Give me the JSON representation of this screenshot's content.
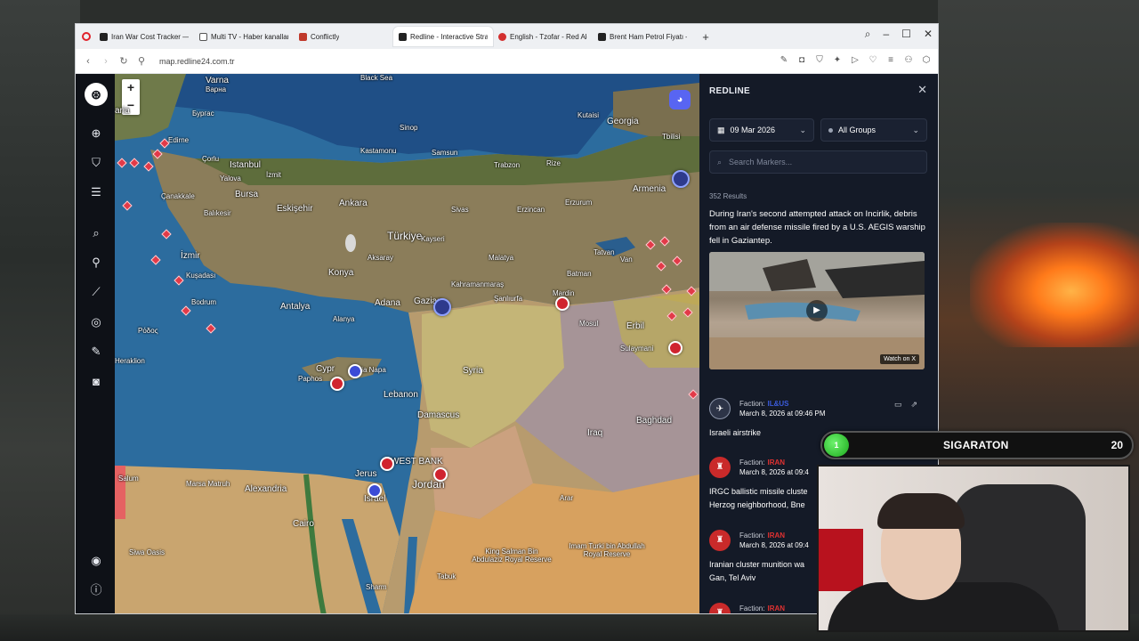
{
  "browser": {
    "tabs": [
      {
        "label": "Iran War Cost Tracker — U",
        "color": "#222222"
      },
      {
        "label": "Multi TV - Haber kanalları",
        "color": "#555555"
      },
      {
        "label": "Conflictly",
        "color": "#c0392b"
      },
      {
        "label": "Redline - Interactive Strat",
        "color": "#222222",
        "active": true
      },
      {
        "label": "English - Tzofar - Red Aler",
        "color": "#d32f2f"
      },
      {
        "label": "Brent Ham Petrol Fiyatı —",
        "color": "#222222"
      }
    ],
    "new_tab": "+",
    "url": "map.redline24.com.tr"
  },
  "map": {
    "zoom_in": "+",
    "zoom_out": "−",
    "labels": {
      "black_sea": "Black Sea",
      "varna": "Varna",
      "varna_bg": "Варна",
      "bulgaria": "aria",
      "burgas": "Бургас",
      "edirne": "Edirne",
      "corlu": "Çorlu",
      "istanbul": "Istanbul",
      "yalova": "Yalova",
      "izmit": "İzmit",
      "bursa": "Bursa",
      "canakkale": "Çanakkale",
      "balikesir": "Balıkesir",
      "eskisehir": "Eskişehir",
      "ankara": "Ankara",
      "izmir": "İzmir",
      "turkiye": "Türkiye",
      "kusadasi": "Kuşadası",
      "konya": "Konya",
      "bodrum": "Bodrum",
      "antalya": "Antalya",
      "alanya": "Alanya",
      "adana": "Adana",
      "gaziantep": "Gazian",
      "sinop": "Sinop",
      "samsun": "Samsun",
      "kastamonu": "Kastamonu",
      "trabzon": "Trabzon",
      "rize": "Rize",
      "sivas": "Sivas",
      "erzincan": "Erzincan",
      "erzurum": "Erzurum",
      "kayseri": "Kayseri",
      "aksaray": "Aksaray",
      "malatya": "Malatya",
      "kahramanmaras": "Kahramanmaraş",
      "sanliurfa": "Şanlıurfa",
      "mardin": "Mardin",
      "batman": "Batman",
      "tatvan": "Tatvan",
      "van": "Van",
      "armenia": "Armenia",
      "georgia": "Georgia",
      "tbilisi": "Tbilisi",
      "kutaisi": "Kutaisi",
      "rhodes": "Ρόδος",
      "heraklion": "Heraklion",
      "cyprus": "Cypr",
      "paphos": "Paphos",
      "ayia_napa": "Ayia Napa",
      "lebanon": "Lebanon",
      "syria": "Syria",
      "damascus": "Damascus",
      "mosul": "Mosul",
      "erbil": "Erbil",
      "sulaymaniyah": "Sulaymani",
      "iraq": "Iraq",
      "baghdad": "Baghdad",
      "west_bank": "WEST BANK",
      "jordan": "Jordan",
      "jerusalem": "Jerus",
      "israel": "Israel",
      "alexandria": "Alexandria",
      "cairo": "Cairo",
      "marsa_matruh": "Marsa Matruh",
      "salum": "Salum",
      "siwa": "Siwa Oasis",
      "sharm": "Sharm",
      "tabuk": "Tabuk",
      "king_salman": "King Salman Bin Abdulaziz Royal Reserve",
      "imam_turki": "Imam Turki bin Abdullah Royal Reserve",
      "arar": "Arar"
    }
  },
  "panel": {
    "title": "REDLINE",
    "date": "09 Mar 2026",
    "group": "All Groups",
    "search_placeholder": "Search Markers...",
    "results": "352 Results",
    "featured_text": "During Iran's second attempted attack on Incirlik, debris from an air defense missile fired by a U.S. AEGIS warship fell in Gaziantep.",
    "video_badge": "Watch on X",
    "feed": [
      {
        "faction_label": "Faction:",
        "faction": "IL&US",
        "faction_color": "#3b5bdb",
        "time": "March 8, 2026 at 09:46 PM",
        "desc": "Israeli airstrike",
        "icon_color": "#2d3447"
      },
      {
        "faction_label": "Faction:",
        "faction": "IRAN",
        "faction_color": "#e03131",
        "time": "March 8, 2026 at 09:4",
        "desc": "IRGC ballistic missile cluste Herzog neighborhood, Bne",
        "icon_color": "#c92a2a"
      },
      {
        "faction_label": "Faction:",
        "faction": "IRAN",
        "faction_color": "#e03131",
        "time": "March 8, 2026 at 09:4",
        "desc": "Iranian cluster munition wa Gan, Tel Aviv",
        "icon_color": "#c92a2a"
      },
      {
        "faction_label": "Faction:",
        "faction": "IRAN",
        "faction_color": "#e03131",
        "time": "",
        "desc": "",
        "icon_color": "#c92a2a"
      }
    ]
  },
  "overlay": {
    "sub_goal_current": "1",
    "sub_goal_name": "SIGARATON",
    "sub_goal_target": "20"
  }
}
